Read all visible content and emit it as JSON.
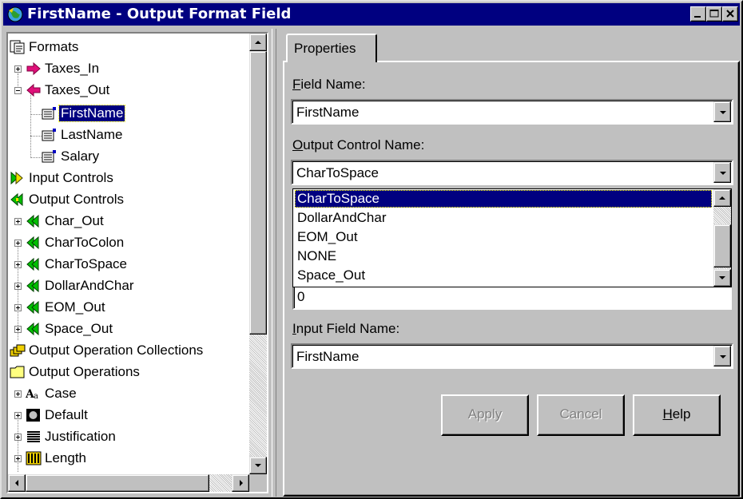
{
  "window": {
    "title": "FirstName - Output Format Field"
  },
  "tree": {
    "items": [
      {
        "label": "Formats",
        "icon": "formats-icon"
      },
      {
        "label": "Taxes_In",
        "icon": "input-arrow-icon"
      },
      {
        "label": "Taxes_Out",
        "icon": "output-arrow-icon"
      },
      {
        "label": "FirstName",
        "icon": "field-icon",
        "selected": true
      },
      {
        "label": "LastName",
        "icon": "field-icon"
      },
      {
        "label": "Salary",
        "icon": "field-icon"
      },
      {
        "label": "Input Controls",
        "icon": "input-controls-icon"
      },
      {
        "label": "Output Controls",
        "icon": "output-controls-icon"
      },
      {
        "label": "Char_Out",
        "icon": "output-control-icon"
      },
      {
        "label": "CharToColon",
        "icon": "output-control-icon"
      },
      {
        "label": "CharToSpace",
        "icon": "output-control-icon"
      },
      {
        "label": "DollarAndChar",
        "icon": "output-control-icon"
      },
      {
        "label": "EOM_Out",
        "icon": "output-control-icon"
      },
      {
        "label": "Space_Out",
        "icon": "output-control-icon"
      },
      {
        "label": "Output Operation Collections",
        "icon": "collections-icon"
      },
      {
        "label": "Output Operations",
        "icon": "folder-icon"
      },
      {
        "label": "Case",
        "icon": "case-icon"
      },
      {
        "label": "Default",
        "icon": "default-icon"
      },
      {
        "label": "Justification",
        "icon": "justification-icon"
      },
      {
        "label": "Length",
        "icon": "length-icon"
      }
    ]
  },
  "properties": {
    "tab_label": "Properties",
    "field_name_label_accel": "F",
    "field_name_label_rest": "ield Name:",
    "field_name_value": "FirstName",
    "output_control_label_accel": "O",
    "output_control_label_rest": "utput Control Name:",
    "output_control_value": "CharToSpace",
    "output_control_options": [
      "CharToSpace",
      "DollarAndChar",
      "EOM_Out",
      "NONE",
      "Space_Out"
    ],
    "hidden_field_value": "0",
    "input_field_label_accel": "I",
    "input_field_label_rest": "nput Field Name:",
    "input_field_value": "FirstName"
  },
  "buttons": {
    "apply": "Apply",
    "cancel": "Cancel",
    "help_accel": "H",
    "help_rest": "elp"
  },
  "colors": {
    "titlebar": "#000080",
    "selection": "#000080",
    "face": "#c0c0c0",
    "input_arrow": "#e0107a",
    "output_arrow": "#e0107a",
    "controls_green": "#00c000"
  }
}
